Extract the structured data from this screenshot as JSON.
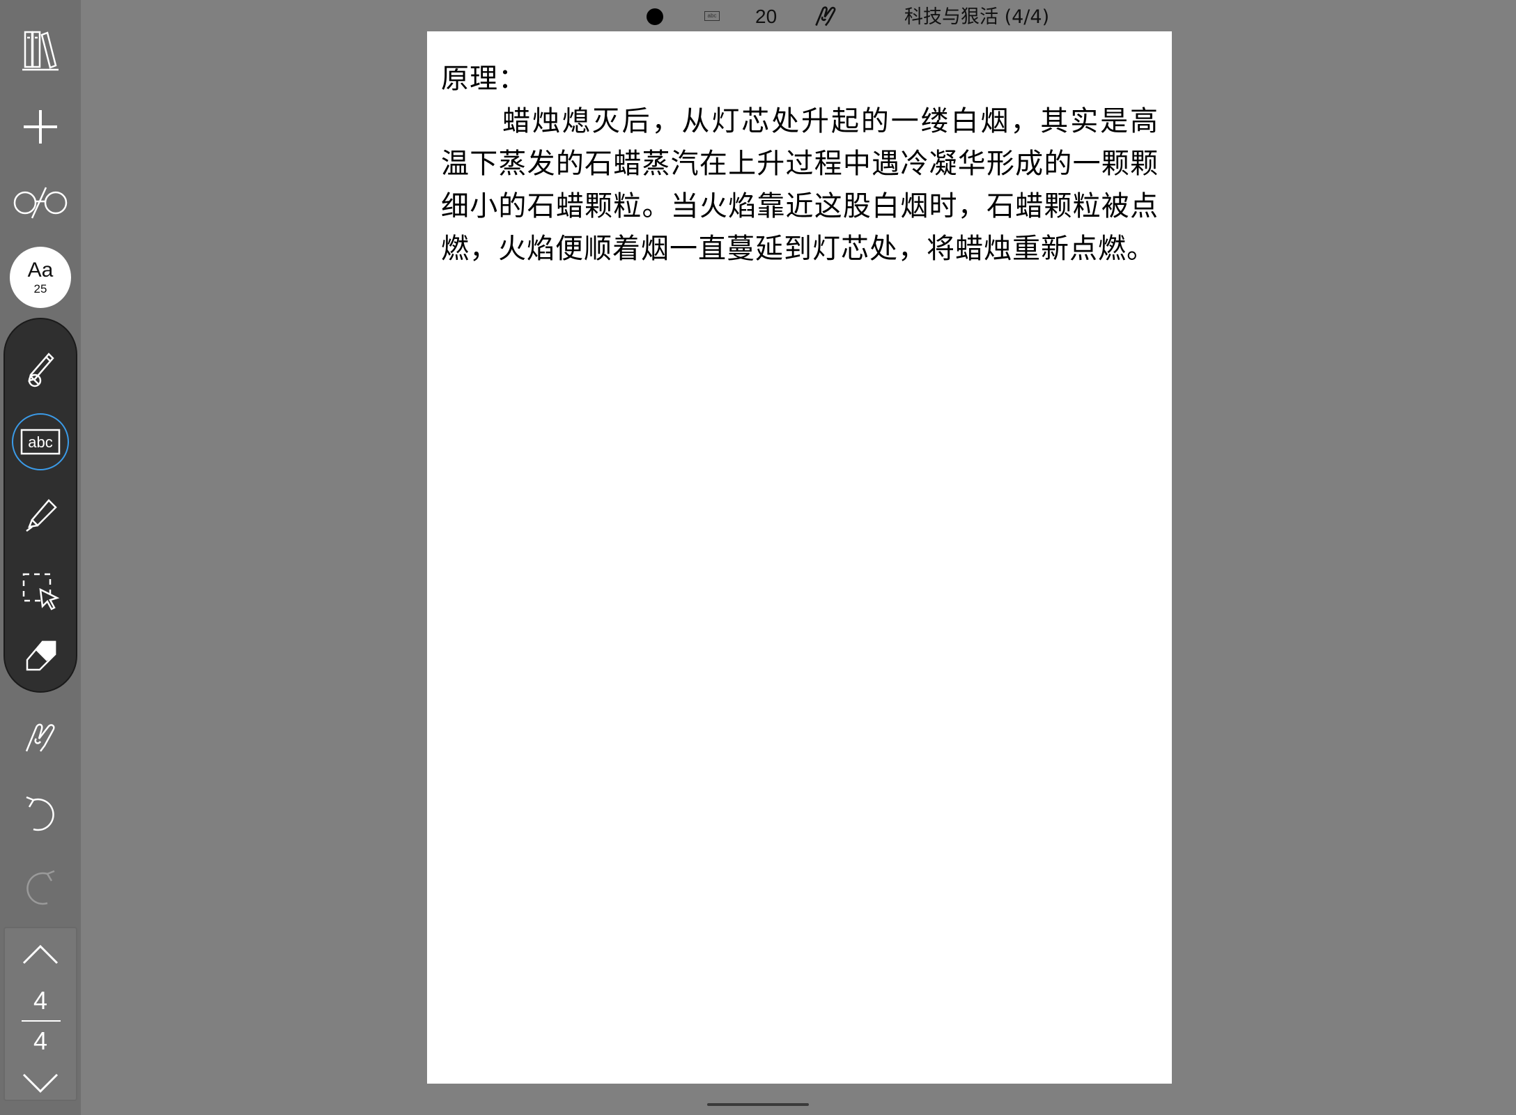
{
  "topbar": {
    "status_dot": "record-dot-icon",
    "mode_icon": "text-box-icon",
    "mode_label": "abc",
    "zoom": "20",
    "hand_icon": "hand-icon",
    "title": "科技与狠活 (4/4)"
  },
  "sidebar": {
    "library_icon": "library-icon",
    "add_icon": "plus-icon",
    "reading_icon": "glasses-icon",
    "font": {
      "label": "Aa",
      "size": "25"
    },
    "tools": [
      {
        "name": "pencil-crossed",
        "icon": "pencil-off-icon"
      },
      {
        "name": "text-box",
        "icon": "text-box-icon",
        "label": "abc",
        "selected": true
      },
      {
        "name": "highlighter",
        "icon": "highlighter-icon"
      },
      {
        "name": "lasso-select",
        "icon": "select-icon"
      },
      {
        "name": "eraser",
        "icon": "eraser-icon"
      }
    ],
    "hand_icon": "hand-icon",
    "undo_icon": "undo-icon",
    "redo_icon": "redo-icon",
    "pager": {
      "current": "4",
      "total": "4",
      "up_icon": "chevron-up-icon",
      "down_icon": "chevron-down-icon"
    }
  },
  "page": {
    "heading": "原理：",
    "paragraph": "蜡烛熄灭后，从灯芯处升起的一缕白烟，其实是高温下蒸发的石蜡蒸汽在上升过程中遇冷凝华形成的一颗颗细小的石蜡颗粒。当火焰靠近这股白烟时，石蜡颗粒被点燃，火焰便顺着烟一直蔓延到灯芯处，将蜡烛重新点燃。"
  },
  "colors": {
    "background": "#808080",
    "sidebar": "#6f6f6f",
    "tool_group": "#2f2f2f",
    "selected_ring": "#3b9be8",
    "page": "#ffffff"
  }
}
